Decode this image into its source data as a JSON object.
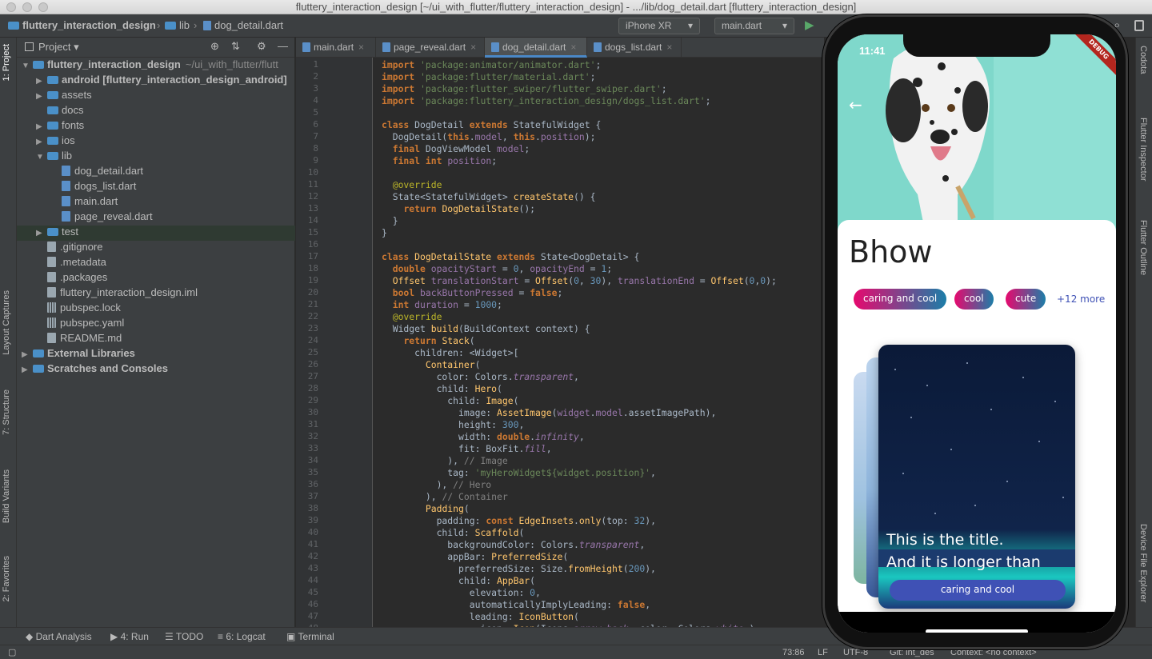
{
  "window": {
    "title": "fluttery_interaction_design [~/ui_with_flutter/fluttery_interaction_design] - .../lib/dog_detail.dart [fluttery_interaction_design]"
  },
  "toolbar": {
    "breadcrumbs": [
      "fluttery_interaction_design",
      "lib",
      "dog_detail.dart"
    ],
    "device": "iPhone XR",
    "run_config": "main.dart"
  },
  "left_tool_tabs": [
    "1: Project",
    "Layout Captures",
    "7: Structure",
    "Build Variants",
    "2: Favorites"
  ],
  "right_tool_tabs": [
    "Codota",
    "Flutter Inspector",
    "Flutter Outline",
    "Device File Explorer"
  ],
  "project_panel": {
    "title": "Project",
    "tree": [
      {
        "label": "fluttery_interaction_design",
        "hint": "~/ui_with_flutter/flutt",
        "type": "folder",
        "depth": 0,
        "expanded": true
      },
      {
        "label": "android [fluttery_interaction_design_android]",
        "type": "folder",
        "depth": 1
      },
      {
        "label": "assets",
        "type": "folder",
        "depth": 1
      },
      {
        "label": "docs",
        "type": "folder",
        "depth": 1,
        "leaf": true
      },
      {
        "label": "fonts",
        "type": "folder",
        "depth": 1
      },
      {
        "label": "ios",
        "type": "folder",
        "depth": 1
      },
      {
        "label": "lib",
        "type": "folder",
        "depth": 1,
        "expanded": true
      },
      {
        "label": "dog_detail.dart",
        "type": "dart",
        "depth": 2
      },
      {
        "label": "dogs_list.dart",
        "type": "dart",
        "depth": 2
      },
      {
        "label": "main.dart",
        "type": "dart",
        "depth": 2
      },
      {
        "label": "page_reveal.dart",
        "type": "dart",
        "depth": 2
      },
      {
        "label": "test",
        "type": "folder",
        "depth": 1,
        "selected": true
      },
      {
        "label": ".gitignore",
        "type": "file",
        "depth": 1
      },
      {
        "label": ".metadata",
        "type": "file",
        "depth": 1
      },
      {
        "label": ".packages",
        "type": "file",
        "depth": 1
      },
      {
        "label": "fluttery_interaction_design.iml",
        "type": "file",
        "depth": 1
      },
      {
        "label": "pubspec.lock",
        "type": "grid",
        "depth": 1
      },
      {
        "label": "pubspec.yaml",
        "type": "grid",
        "depth": 1
      },
      {
        "label": "README.md",
        "type": "file",
        "depth": 1
      },
      {
        "label": "External Libraries",
        "type": "lib",
        "depth": 0
      },
      {
        "label": "Scratches and Consoles",
        "type": "lib",
        "depth": 0
      }
    ]
  },
  "editor": {
    "tabs": [
      "main.dart",
      "page_reveal.dart",
      "dog_detail.dart",
      "dogs_list.dart"
    ],
    "active_tab": "dog_detail.dart",
    "lines": [
      "import 'package:animator/animator.dart';",
      "import 'package:flutter/material.dart';",
      "import 'package:flutter_swiper/flutter_swiper.dart';",
      "import 'package:fluttery_interaction_design/dogs_list.dart';",
      "",
      "class DogDetail extends StatefulWidget {",
      "  DogDetail(this.model, this.position);",
      "  final DogViewModel model;",
      "  final int position;",
      "",
      "  @override",
      "  State<StatefulWidget> createState() {",
      "    return DogDetailState();",
      "  }",
      "}",
      "",
      "class DogDetailState extends State<DogDetail> {",
      "  double opacityStart = 0, opacityEnd = 1;",
      "  Offset translationStart = Offset(0, 30), translationEnd = Offset(0,0);",
      "  bool backButtonPressed = false;",
      "  int duration = 1000;",
      "  @override",
      "  Widget build(BuildContext context) {",
      "    return Stack(",
      "      children: <Widget>[",
      "        Container(",
      "          color: Colors.transparent,",
      "          child: Hero(",
      "            child: Image(",
      "              image: AssetImage(widget.model.assetImagePath),",
      "              height: 300,",
      "              width: double.infinity,",
      "              fit: BoxFit.fill,",
      "            ), // Image",
      "            tag: 'myHeroWidget${widget.position}',",
      "          ), // Hero",
      "        ), // Container",
      "        Padding(",
      "          padding: const EdgeInsets.only(top: 32),",
      "          child: Scaffold(",
      "            backgroundColor: Colors.transparent,",
      "            appBar: PreferredSize(",
      "              preferredSize: Size.fromHeight(200),",
      "              child: AppBar(",
      "                elevation: 0,",
      "                automaticallyImplyLeading: false,",
      "                leading: IconButton(",
      "                  icon: Icon(Icons.arrow_back, color: Colors.white,),"
    ]
  },
  "bottom_tabs": [
    "Dart Analysis",
    "4: Run",
    "TODO",
    "6: Logcat",
    "Terminal"
  ],
  "status_bar": {
    "position": "73:86",
    "line_sep": "LF",
    "encoding": "UTF-8",
    "git": "Git: int_des",
    "context": "Context: <no context>"
  },
  "phone": {
    "time": "11:41",
    "debug_label": "DEBUG",
    "dog_name": "Bhow",
    "chips": [
      "caring and cool",
      "cool",
      "cute"
    ],
    "more": "+12 more",
    "card": {
      "title_line1": "This is the title.",
      "title_line2": "And it is longer than",
      "chip": "caring and cool"
    }
  }
}
